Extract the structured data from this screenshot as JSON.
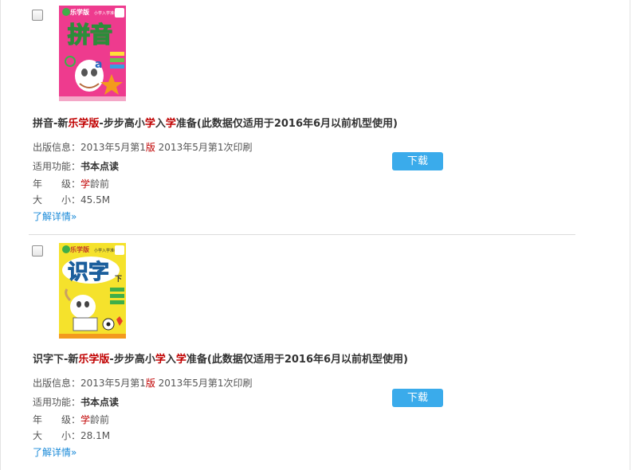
{
  "books": [
    {
      "title_parts": [
        {
          "t": "拼音-新",
          "hl": false
        },
        {
          "t": "乐学版",
          "hl": true
        },
        {
          "t": "-步步高小",
          "hl": false
        },
        {
          "t": "学",
          "hl": true
        },
        {
          "t": "入",
          "hl": false
        },
        {
          "t": "学",
          "hl": true
        },
        {
          "t": "准备(此数据仅适用于2016年6月以前机型使用)",
          "hl": false
        }
      ],
      "pub_label": "出版信息：",
      "pub_a": "2013年5月第1",
      "pub_hl": "版",
      "pub_b": " 2013年5月第1次印刷",
      "func_label": "适用功能：",
      "func_value": "书本点读",
      "grade_label": "年　　级：",
      "grade_hl": "学",
      "grade_value": "龄前",
      "size_label": "大　　小：",
      "size_value": "45.5M",
      "more": "了解详情»",
      "download": "下载",
      "cover": {
        "brand": "乐学版",
        "sub": "小学入学准备",
        "big": "拼音",
        "bg": "#ee3b8e",
        "badge": "学龄前"
      }
    },
    {
      "title_parts": [
        {
          "t": "识字下-新",
          "hl": false
        },
        {
          "t": "乐学版",
          "hl": true
        },
        {
          "t": "-步步高小",
          "hl": false
        },
        {
          "t": "学",
          "hl": true
        },
        {
          "t": "入",
          "hl": false
        },
        {
          "t": "学",
          "hl": true
        },
        {
          "t": "准备(此数据仅适用于2016年6月以前机型使用)",
          "hl": false
        }
      ],
      "pub_label": "出版信息：",
      "pub_a": "2013年5月第1",
      "pub_hl": "版",
      "pub_b": " 2013年5月第1次印刷",
      "func_label": "适用功能：",
      "func_value": "书本点读",
      "grade_label": "年　　级：",
      "grade_hl": "学",
      "grade_value": "龄前",
      "size_label": "大　　小：",
      "size_value": "28.1M",
      "more": "了解详情»",
      "download": "下载",
      "cover": {
        "brand": "乐学版",
        "sub": "小学入学准备",
        "big": "识字",
        "suffix": "下",
        "bg": "#f5e22c",
        "badge": "学龄前"
      }
    }
  ]
}
